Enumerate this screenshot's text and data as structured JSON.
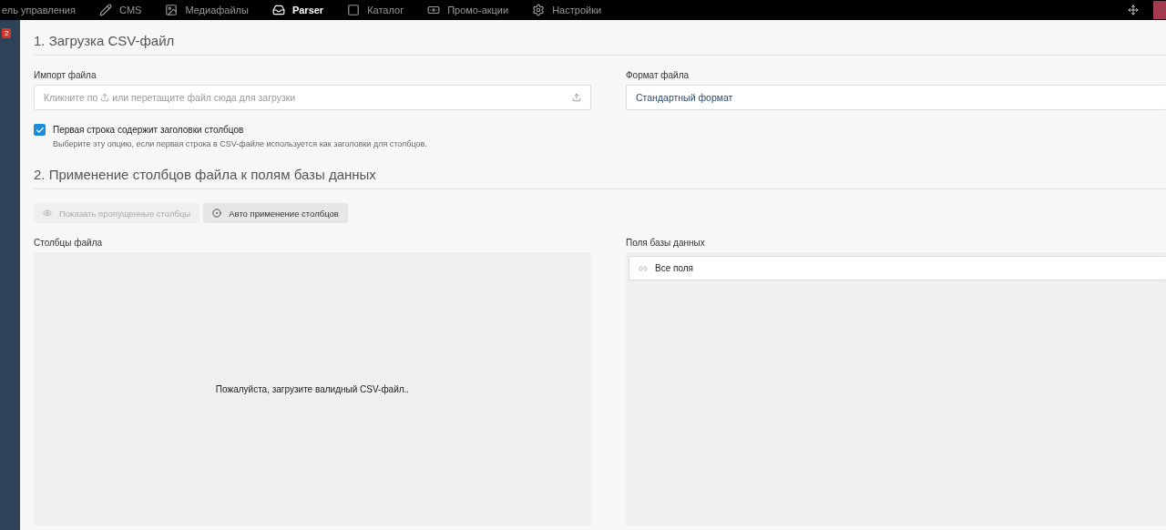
{
  "top_nav": {
    "items": [
      {
        "label": "ель управления",
        "selected": false
      },
      {
        "label": "CMS",
        "selected": false
      },
      {
        "label": "Медиафайлы",
        "selected": false
      },
      {
        "label": "Parser",
        "selected": true
      },
      {
        "label": "Каталог",
        "selected": false
      },
      {
        "label": "Промо-акции",
        "selected": false
      },
      {
        "label": "Настройки",
        "selected": false
      }
    ]
  },
  "sidebar": {
    "badge": "2"
  },
  "upload_section": {
    "title": "1. Загрузка CSV-файл",
    "import": {
      "label": "Импорт файла",
      "hint_before": "Кликните по",
      "hint_after": "или перетащите файл сюда для загрузки"
    },
    "format": {
      "label": "Формат файла",
      "value": "Стандартный формат"
    },
    "header_option": {
      "label": "Первая строка содержит заголовки столбцов",
      "checked": true,
      "help": "Выберите эту опцию, если первая строка в CSV-файле используется как заголовки для столбцов."
    }
  },
  "mapping_section": {
    "title": "2. Применение столбцов файла к полям базы данных",
    "buttons": [
      {
        "label": "Показать пропущенные столбцы",
        "disabled": true
      },
      {
        "label": "Авто применение столбцов",
        "disabled": false
      }
    ],
    "file_columns": {
      "label": "Столбцы файла",
      "empty_message": "Пожалуйста, загрузите валидный CSV-файл.."
    },
    "db_fields": {
      "label": "Поля базы данных",
      "filter": "Все поля"
    }
  }
}
